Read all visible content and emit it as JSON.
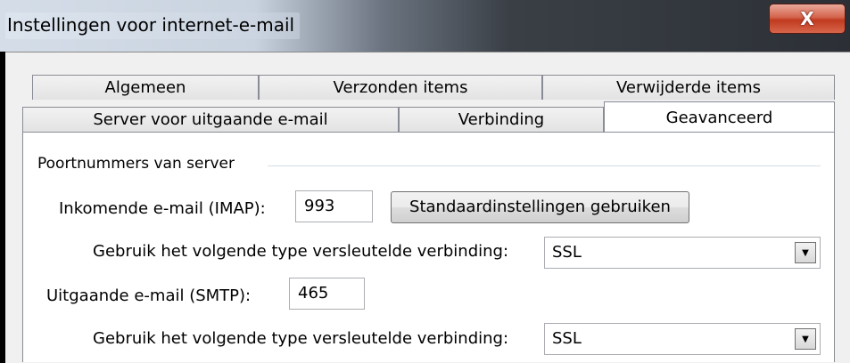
{
  "window": {
    "title": "Instellingen voor internet-e-mail",
    "close_glyph": "X"
  },
  "tabs_row1": [
    "Algemeen",
    "Verzonden items",
    "Verwijderde items"
  ],
  "tabs_row2": [
    "Server voor uitgaande e-mail",
    "Verbinding",
    "Geavanceerd"
  ],
  "active_tab": "Geavanceerd",
  "ports": {
    "group_label": "Poortnummers van server",
    "incoming_label": "Inkomende e-mail (IMAP):",
    "incoming_value": "993",
    "defaults_button": "Standaardinstellingen gebruiken",
    "incoming_encryption_label": "Gebruik het volgende type versleutelde verbinding:",
    "incoming_encryption_value": "SSL",
    "outgoing_label": "Uitgaande e-mail (SMTP):",
    "outgoing_value": "465",
    "outgoing_encryption_label": "Gebruik het volgende type versleutelde verbinding:",
    "outgoing_encryption_value": "SSL"
  },
  "icons": {
    "close": "close-icon",
    "dropdown": "chevron-down-icon"
  }
}
